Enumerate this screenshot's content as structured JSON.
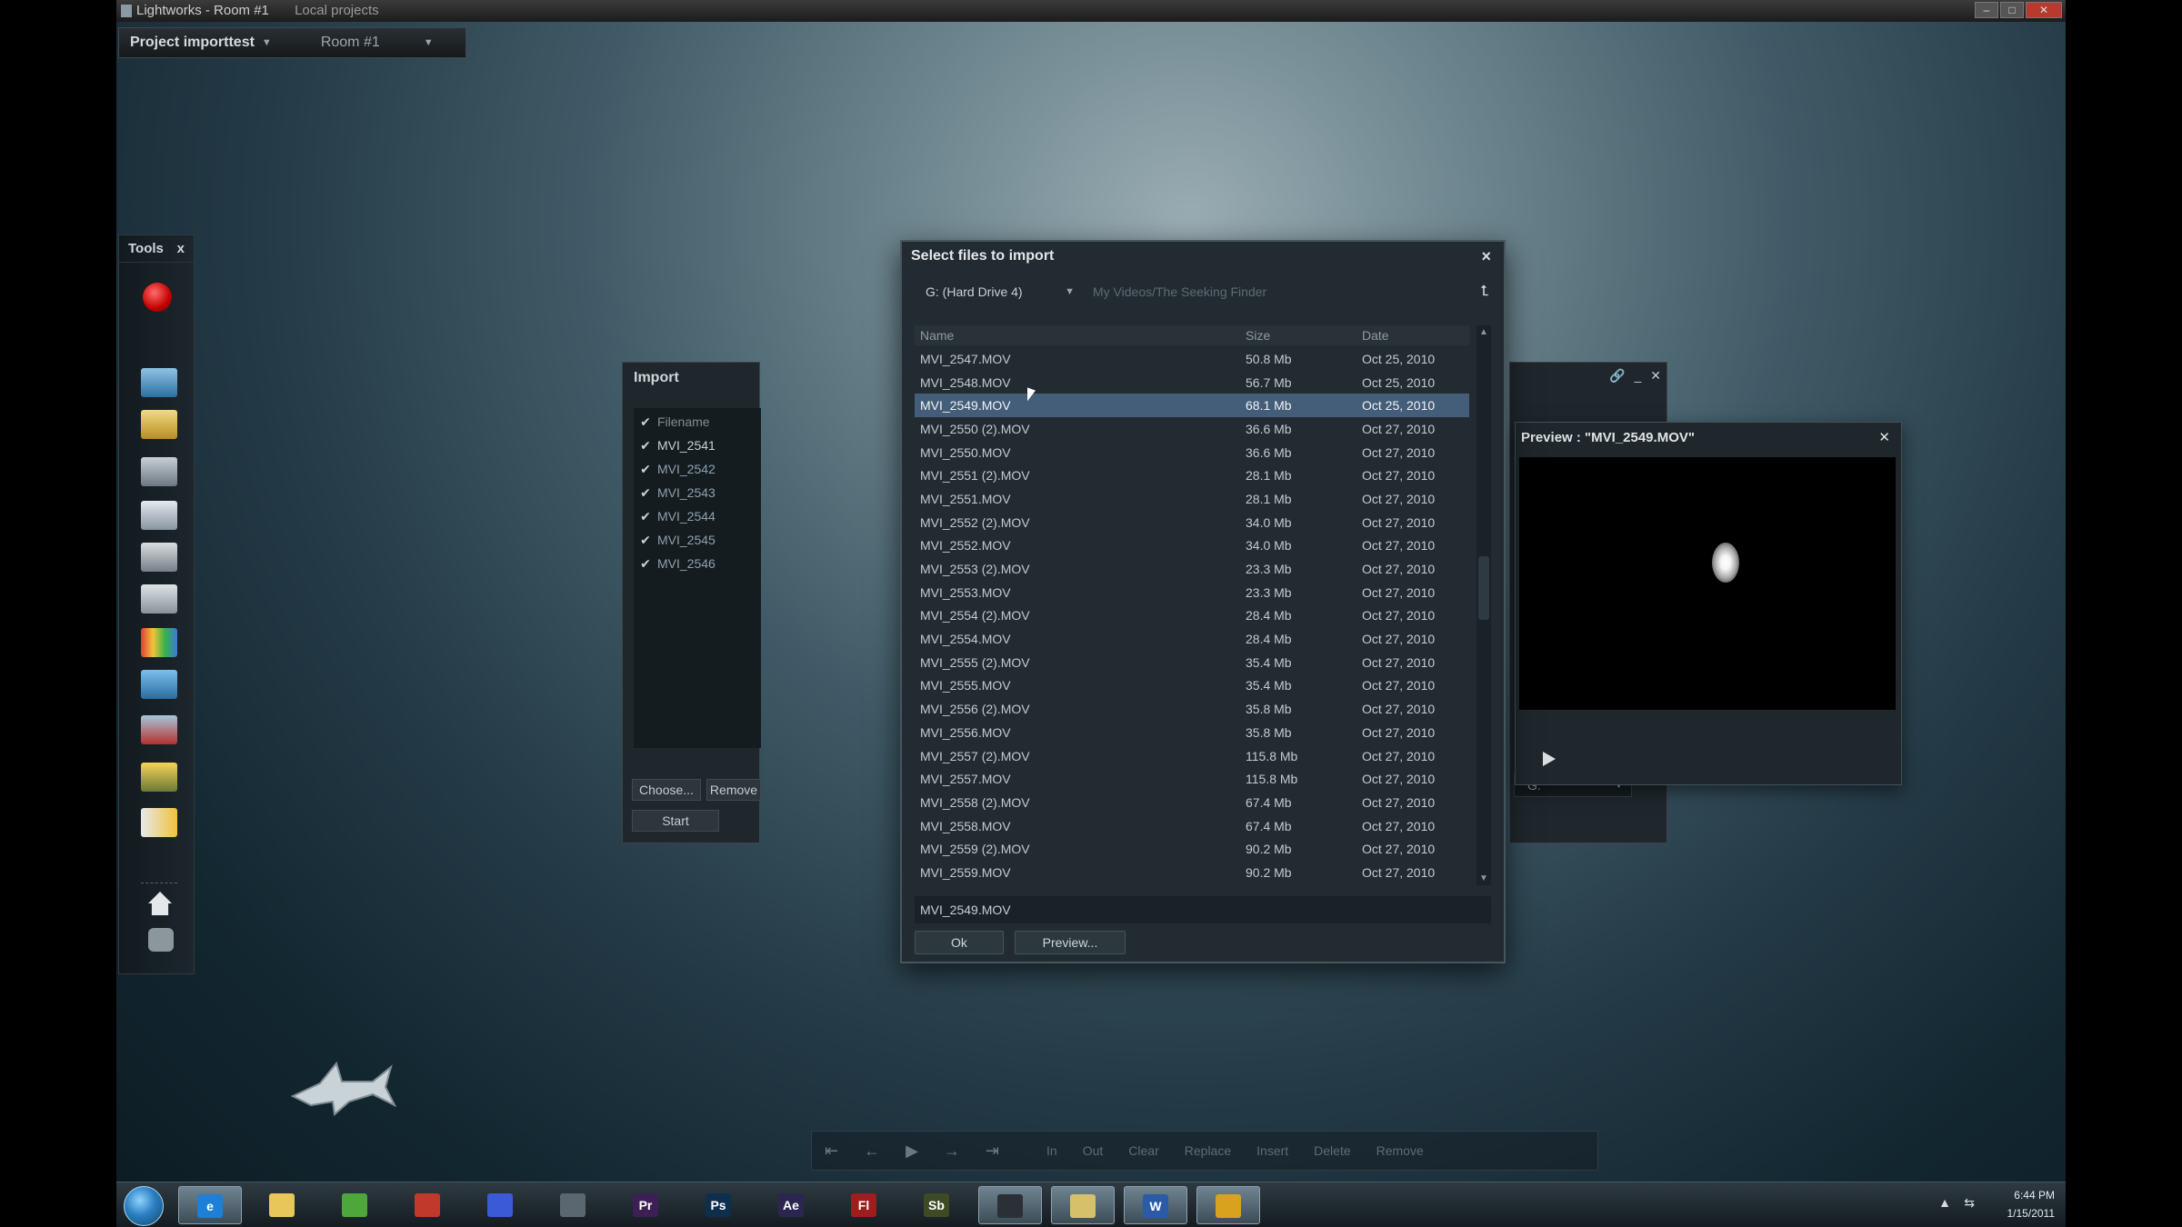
{
  "window": {
    "title": "Lightworks - Room #1",
    "title_extra": "Local projects",
    "controls": [
      "–",
      "□",
      "✕"
    ]
  },
  "project_bar": {
    "project": "Project importtest",
    "room": "Room #1"
  },
  "tools": {
    "title": "Tools",
    "close": "x"
  },
  "import_panel": {
    "title": "Import",
    "column": "Filename",
    "files": [
      "MVI_2541",
      "MVI_2542",
      "MVI_2543",
      "MVI_2544",
      "MVI_2545",
      "MVI_2546"
    ],
    "choose_label": "Choose...",
    "remove_label": "Remove",
    "start_label": "Start"
  },
  "right_panel": {
    "drive_label": "G:"
  },
  "preview": {
    "title": "Preview : \"MVI_2549.MOV\""
  },
  "dialog": {
    "title": "Select files to import",
    "close": "×",
    "drive": "G: (Hard Drive 4)",
    "path": "My Videos/The Seeking Finder",
    "columns": {
      "name": "Name",
      "size": "Size",
      "date": "Date"
    },
    "files": [
      {
        "name": "MVI_2547.MOV",
        "size": "50.8 Mb",
        "date": "Oct 25, 2010"
      },
      {
        "name": "MVI_2548.MOV",
        "size": "56.7 Mb",
        "date": "Oct 25, 2010"
      },
      {
        "name": "MVI_2549.MOV",
        "size": "68.1 Mb",
        "date": "Oct 25, 2010"
      },
      {
        "name": "MVI_2550 (2).MOV",
        "size": "36.6 Mb",
        "date": "Oct 27, 2010"
      },
      {
        "name": "MVI_2550.MOV",
        "size": "36.6 Mb",
        "date": "Oct 27, 2010"
      },
      {
        "name": "MVI_2551 (2).MOV",
        "size": "28.1 Mb",
        "date": "Oct 27, 2010"
      },
      {
        "name": "MVI_2551.MOV",
        "size": "28.1 Mb",
        "date": "Oct 27, 2010"
      },
      {
        "name": "MVI_2552 (2).MOV",
        "size": "34.0 Mb",
        "date": "Oct 27, 2010"
      },
      {
        "name": "MVI_2552.MOV",
        "size": "34.0 Mb",
        "date": "Oct 27, 2010"
      },
      {
        "name": "MVI_2553 (2).MOV",
        "size": "23.3 Mb",
        "date": "Oct 27, 2010"
      },
      {
        "name": "MVI_2553.MOV",
        "size": "23.3 Mb",
        "date": "Oct 27, 2010"
      },
      {
        "name": "MVI_2554 (2).MOV",
        "size": "28.4 Mb",
        "date": "Oct 27, 2010"
      },
      {
        "name": "MVI_2554.MOV",
        "size": "28.4 Mb",
        "date": "Oct 27, 2010"
      },
      {
        "name": "MVI_2555 (2).MOV",
        "size": "35.4 Mb",
        "date": "Oct 27, 2010"
      },
      {
        "name": "MVI_2555.MOV",
        "size": "35.4 Mb",
        "date": "Oct 27, 2010"
      },
      {
        "name": "MVI_2556 (2).MOV",
        "size": "35.8 Mb",
        "date": "Oct 27, 2010"
      },
      {
        "name": "MVI_2556.MOV",
        "size": "35.8 Mb",
        "date": "Oct 27, 2010"
      },
      {
        "name": "MVI_2557 (2).MOV",
        "size": "115.8 Mb",
        "date": "Oct 27, 2010"
      },
      {
        "name": "MVI_2557.MOV",
        "size": "115.8 Mb",
        "date": "Oct 27, 2010"
      },
      {
        "name": "MVI_2558 (2).MOV",
        "size": "67.4 Mb",
        "date": "Oct 27, 2010"
      },
      {
        "name": "MVI_2558.MOV",
        "size": "67.4 Mb",
        "date": "Oct 27, 2010"
      },
      {
        "name": "MVI_2559 (2).MOV",
        "size": "90.2 Mb",
        "date": "Oct 27, 2010"
      },
      {
        "name": "MVI_2559.MOV",
        "size": "90.2 Mb",
        "date": "Oct 27, 2010"
      }
    ],
    "selected_file": "MVI_2549.MOV",
    "ok_label": "Ok",
    "preview_label": "Preview..."
  },
  "transport": {
    "labels": [
      "In",
      "Out",
      "Clear",
      "Replace",
      "Insert",
      "Delete",
      "Remove"
    ]
  },
  "taskbar": {
    "apps": [
      {
        "icon": "ie-icon",
        "glyph": "e",
        "color": "#1e7fd6"
      },
      {
        "icon": "folder-icon",
        "glyph": "",
        "color": "#e8c65a"
      },
      {
        "icon": "chrome-icon",
        "glyph": "",
        "color": "#4ea73a"
      },
      {
        "icon": "app-red-icon",
        "glyph": "",
        "color": "#c0392b"
      },
      {
        "icon": "app-blue-icon",
        "glyph": "",
        "color": "#3b5bd6"
      },
      {
        "icon": "app-gray-icon",
        "glyph": "",
        "color": "#5a6670"
      },
      {
        "icon": "premiere-icon",
        "glyph": "Pr",
        "color": "#3d1f55"
      },
      {
        "icon": "photoshop-icon",
        "glyph": "Ps",
        "color": "#0d2f4d"
      },
      {
        "icon": "aftereffects-icon",
        "glyph": "Ae",
        "color": "#2a2650"
      },
      {
        "icon": "flash-icon",
        "glyph": "Fl",
        "color": "#a01d1d"
      },
      {
        "icon": "soundbooth-icon",
        "glyph": "Sb",
        "color": "#3e4a23"
      },
      {
        "icon": "lightworks-icon",
        "glyph": "",
        "color": "#2a3036"
      },
      {
        "icon": "explorer-icon",
        "glyph": "",
        "color": "#d6c16a"
      },
      {
        "icon": "word-icon",
        "glyph": "W",
        "color": "#2b5aa6"
      },
      {
        "icon": "lock-icon",
        "glyph": "",
        "color": "#d8a21f"
      }
    ],
    "time": "6:44 PM",
    "date": "1/15/2011"
  }
}
